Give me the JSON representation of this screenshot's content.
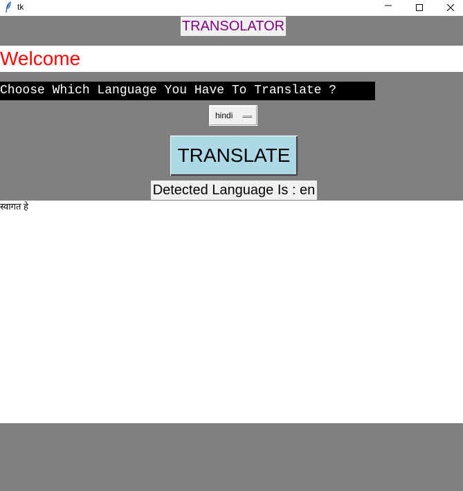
{
  "window": {
    "title": "tk"
  },
  "app": {
    "title": "TRANSOLATOR",
    "welcome": "Welcome",
    "prompt": "Choose Which Language You Have To Translate ?",
    "language_select": {
      "selected": "hindi"
    },
    "translate_label": "TRANSLATE",
    "detected_text": "Detected Language Is : en",
    "output_text": "स्वागत हे"
  },
  "colors": {
    "panel_gray": "#808080",
    "title_text": "#800080",
    "welcome_text": "#ff0000",
    "button_bg": "#add8e6"
  }
}
